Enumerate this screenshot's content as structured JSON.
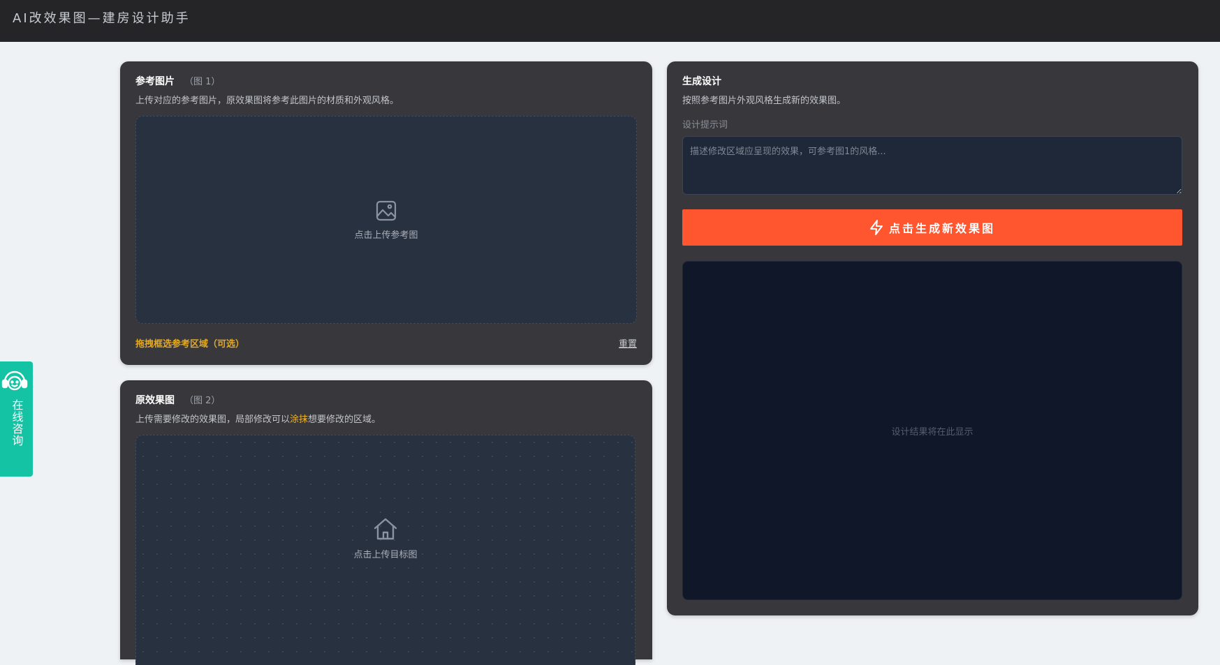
{
  "app": {
    "title": "AI改效果图—建房设计助手"
  },
  "reference_panel": {
    "title": "参考图片",
    "tag": "（图 1）",
    "description": "上传对应的参考图片，原效果图将参考此图片的材质和外观风格。",
    "upload_label": "点击上传参考图",
    "region_hint": "拖拽框选参考区域（可选）",
    "reset_label": "重置",
    "icon": "image-icon"
  },
  "original_panel": {
    "title": "原效果图",
    "tag": "（图 2）",
    "description_prefix": "上传需要修改的效果图，局部修改可以",
    "description_highlight": "涂抹",
    "description_suffix": "想要修改的区域。",
    "upload_label": "点击上传目标图",
    "icon": "house-icon"
  },
  "generate_panel": {
    "title": "生成设计",
    "description": "按照参考图片外观风格生成新的效果图。",
    "prompt_label": "设计提示词",
    "prompt_placeholder": "描述修改区域应呈现的效果，可参考图1的风格...",
    "prompt_value": "",
    "button_label": "点击生成新效果图",
    "button_icon": "lightning-icon",
    "result_placeholder": "设计结果将在此显示"
  },
  "consult": {
    "label": "在线咨询",
    "icon": "headset-icon"
  },
  "colors": {
    "accent": "#ff5630",
    "highlight": "#f0b429",
    "consult": "#14c2a4",
    "panel": "#38373b",
    "topbar": "#252528"
  }
}
